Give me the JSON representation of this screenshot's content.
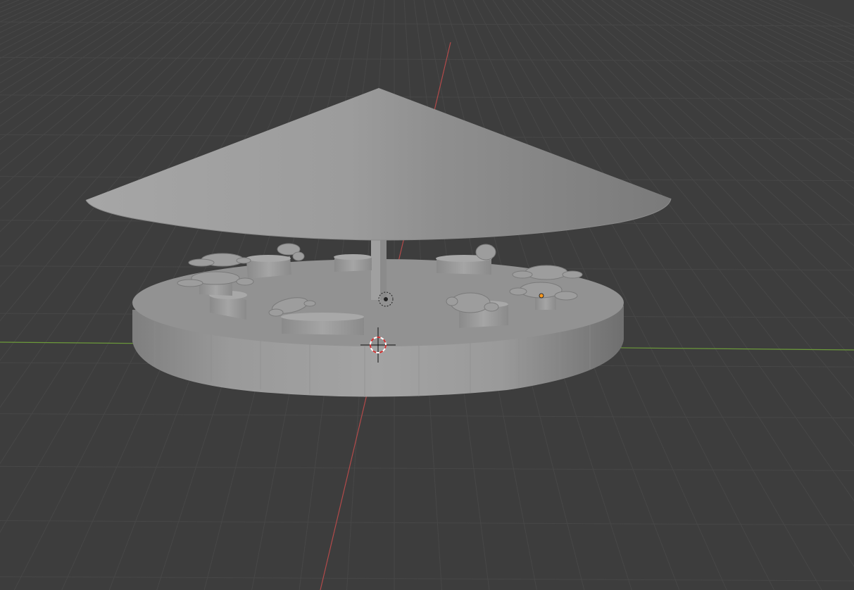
{
  "app": "3D viewport",
  "viewport": {
    "background": "#3d3d3d",
    "grid_color": "#474747",
    "axis_x_color": "#b34a4a",
    "axis_y_color": "#6c9a3a",
    "mesh_color": "#9a9a9a"
  },
  "scene": {
    "objects": [
      "carousel-base",
      "carousel-roof-cone",
      "center-pole",
      "seat-bench-1",
      "seat-bench-2",
      "seat-bench-3",
      "seat-bench-4",
      "seat-bench-5",
      "seat-bench-6",
      "seat-bench-7",
      "seat-bench-8",
      "monkey-head-rider-1",
      "monkey-head-rider-2",
      "monkey-head-rider-3",
      "monkey-head-rider-4",
      "monkey-head-rider-5",
      "monkey-head-rider-6",
      "monkey-head-rider-7"
    ],
    "selected_origin_color": "#ff9a1e",
    "cursor_icon": "3d-cursor-icon"
  }
}
